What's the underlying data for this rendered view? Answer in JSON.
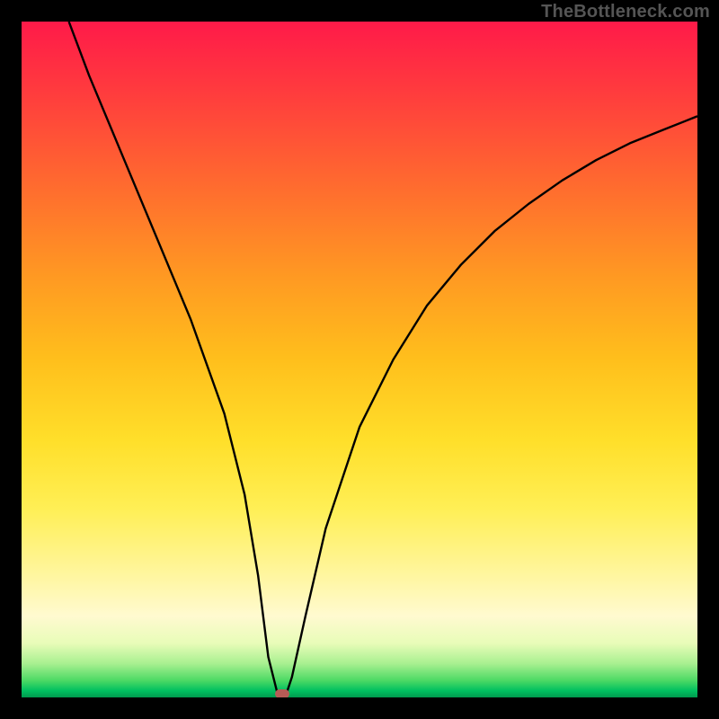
{
  "watermark": "TheBottleneck.com",
  "chart_data": {
    "type": "line",
    "title": "",
    "xlabel": "",
    "ylabel": "",
    "xlim": [
      0,
      100
    ],
    "ylim": [
      0,
      100
    ],
    "grid": false,
    "legend": null,
    "gradient_stops": [
      {
        "pos": 0,
        "color": "#ff1a49"
      },
      {
        "pos": 0.1,
        "color": "#ff3a3e"
      },
      {
        "pos": 0.24,
        "color": "#ff6a2f"
      },
      {
        "pos": 0.38,
        "color": "#ff9a22"
      },
      {
        "pos": 0.5,
        "color": "#ffbf1c"
      },
      {
        "pos": 0.62,
        "color": "#ffdf2a"
      },
      {
        "pos": 0.72,
        "color": "#ffef55"
      },
      {
        "pos": 0.82,
        "color": "#fff6a0"
      },
      {
        "pos": 0.88,
        "color": "#fffad0"
      },
      {
        "pos": 0.92,
        "color": "#e8fcb8"
      },
      {
        "pos": 0.95,
        "color": "#a8f090"
      },
      {
        "pos": 0.975,
        "color": "#4cd964"
      },
      {
        "pos": 0.99,
        "color": "#00c060"
      },
      {
        "pos": 1.0,
        "color": "#009a4e"
      }
    ],
    "series": [
      {
        "name": "curve",
        "x": [
          7,
          10,
          15,
          20,
          25,
          30,
          33,
          35,
          36.5,
          38,
          39,
          40,
          42,
          45,
          50,
          55,
          60,
          65,
          70,
          75,
          80,
          85,
          90,
          95,
          100
        ],
        "y": [
          100,
          92,
          80,
          68,
          56,
          42,
          30,
          18,
          6,
          0,
          0,
          3,
          12,
          25,
          40,
          50,
          58,
          64,
          69,
          73,
          76.5,
          79.5,
          82,
          84,
          86
        ]
      }
    ],
    "marker": {
      "x": 38.5,
      "y": 0,
      "color": "#b65b56"
    }
  }
}
